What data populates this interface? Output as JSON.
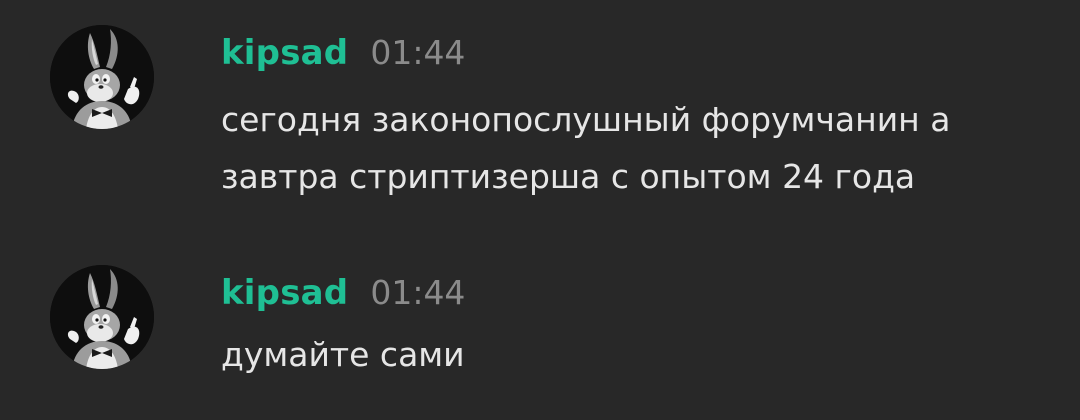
{
  "colors": {
    "background": "#282828",
    "username": "#1fbf94",
    "timestamp": "#8b8b8b",
    "text": "#e6e6e6"
  },
  "messages": [
    {
      "author": "kipsad",
      "time": "01:44",
      "avatar_icon": "bugs-bunny-avatar-icon",
      "text": "сегодня законопослушный форумчанин а\nзавтра стриптизерша с опытом 24 года"
    },
    {
      "author": "kipsad",
      "time": "01:44",
      "avatar_icon": "bugs-bunny-avatar-icon",
      "text": "думайте сами"
    }
  ]
}
